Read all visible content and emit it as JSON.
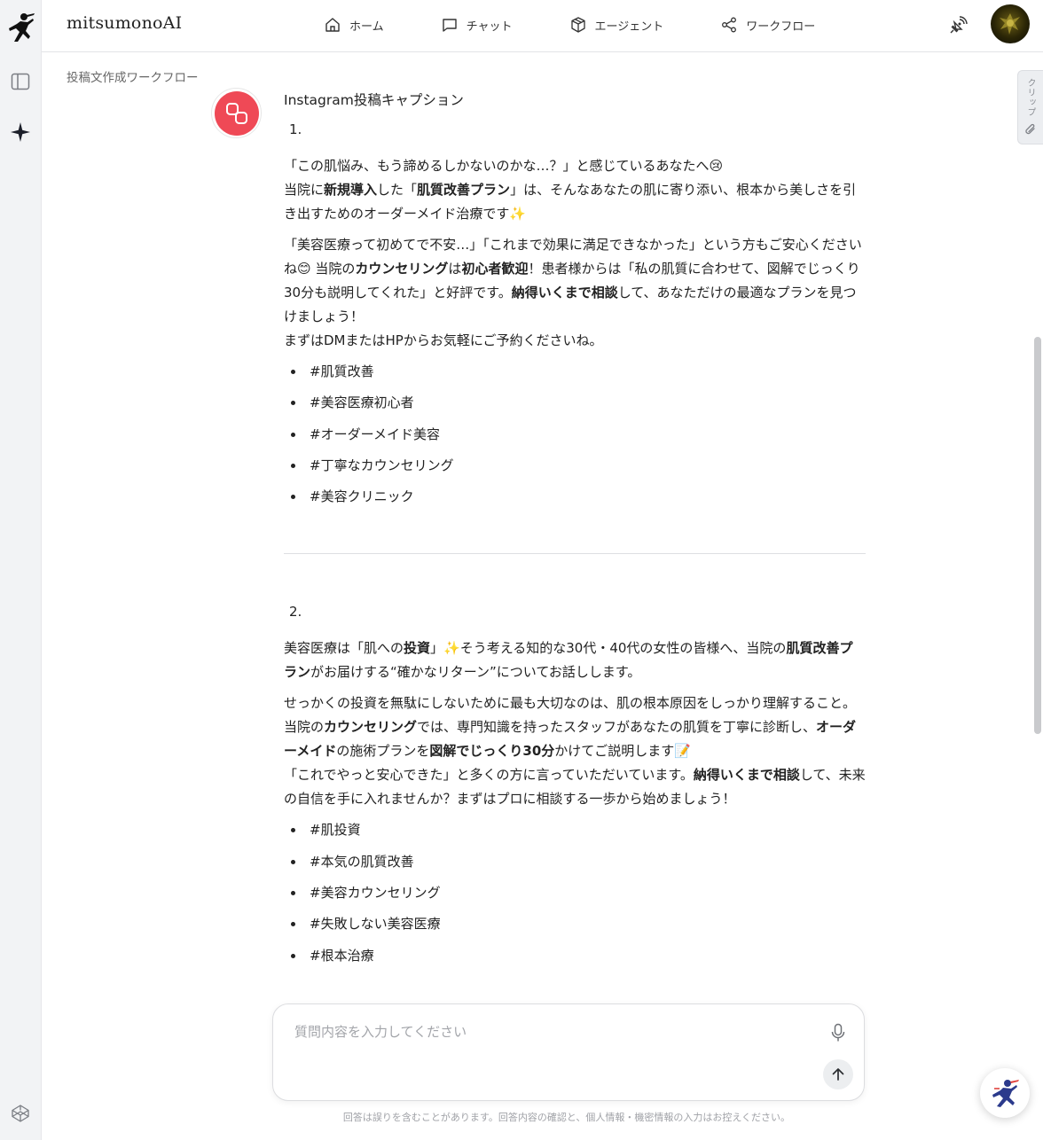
{
  "app": {
    "brand": "mitsumonoAI"
  },
  "nav": [
    {
      "label": "ホーム",
      "icon": "home-icon"
    },
    {
      "label": "チャット",
      "icon": "chat-icon"
    },
    {
      "label": "エージェント",
      "icon": "cube-icon"
    },
    {
      "label": "ワークフロー",
      "icon": "share-icon"
    }
  ],
  "breadcrumb": "投稿文作成ワークフロー",
  "clip_tab": {
    "label": "クリップ"
  },
  "message": {
    "title": "Instagram投稿キャプション",
    "items": [
      {
        "number": "1.",
        "p1_line1": "「この肌悩み、もう諦めるしかないのかな…？」と感じているあなたへ😢",
        "p1_line2_pre": "当院に",
        "p1_line2_b1": "新規導入",
        "p1_line2_mid": "した「",
        "p1_line2_b2": "肌質改善プラン",
        "p1_line2_post": "」は、そんなあなたの肌に寄り添い、根本から美しさを引き出すためのオーダーメイド治療です✨",
        "p2_pre": "「美容医療って初めてで不安…」「これまで効果に満足できなかった」という方もご安心くださいね😊 当院の",
        "p2_b1": "カウンセリング",
        "p2_mid1": "は",
        "p2_b2": "初心者歓迎",
        "p2_mid2": "！患者様からは「私の肌質に合わせて、図解でじっくり30分も説明してくれた」と好評です。",
        "p2_b3": "納得いくまで相談",
        "p2_post": "して、あなただけの最適なプランを見つけましょう！",
        "p2_line2": "まずはDMまたはHPからお気軽にご予約くださいね。",
        "tags": [
          "#肌質改善",
          "#美容医療初心者",
          "#オーダーメイド美容",
          "#丁寧なカウンセリング",
          "#美容クリニック"
        ]
      },
      {
        "number": "2.",
        "p1_pre": "美容医療は「肌への",
        "p1_b1": "投資",
        "p1_mid": "」✨そう考える知的な30代・40代の女性の皆様へ、当院の",
        "p1_b2": "肌質改善プラン",
        "p1_post": "がお届けする“確かなリターン”についてお話しします。",
        "p2_pre": "せっかくの投資を無駄にしないために最も大切なのは、肌の根本原因をしっかり理解すること。当院の",
        "p2_b1": "カウンセリング",
        "p2_mid1": "では、専門知識を持ったスタッフがあなたの肌質を丁寧に診断し、",
        "p2_b2": "オーダーメイド",
        "p2_mid2": "の施術プランを",
        "p2_b3": "図解でじっくり30分",
        "p2_mid3": "かけてご説明します📝",
        "p2_line2_pre": "「これでやっと安心できた」と多くの方に言っていただいています。",
        "p2_line2_b": "納得いくまで相談",
        "p2_line2_post": "して、未来の自信を手に入れませんか？まずはプロに相談する一歩から始めましょう！",
        "tags": [
          "#肌投資",
          "#本気の肌質改善",
          "#美容カウンセリング",
          "#失敗しない美容医療",
          "#根本治療"
        ]
      }
    ]
  },
  "input": {
    "placeholder": "質問内容を入力してください",
    "value": ""
  },
  "disclaimer": "回答は誤りを含むことがあります。回答内容の確認と、個人情報・機密情報の入力はお控えください。",
  "colors": {
    "bot_avatar": "#ef4956",
    "accent_fab": "#2b3a8c"
  }
}
